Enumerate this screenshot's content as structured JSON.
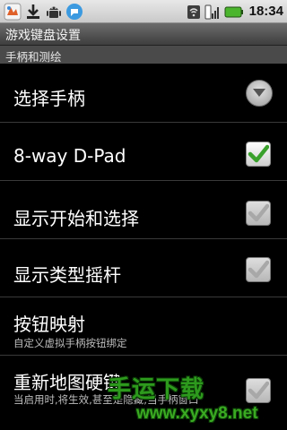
{
  "status_bar": {
    "time": "18:34",
    "icons": [
      "app-icon",
      "download-icon",
      "android-icon",
      "chat-icon",
      "wifi-icon",
      "signal-icon",
      "battery-icon"
    ]
  },
  "title_bar": {
    "title": "游戏键盘设置"
  },
  "category": {
    "label": "手柄和测绘"
  },
  "preferences": [
    {
      "title": "选择手柄",
      "widget": "dropdown"
    },
    {
      "title": "8-way D-Pad",
      "widget": "checkbox",
      "checked": true,
      "enabled": true
    },
    {
      "title": "显示开始和选择",
      "widget": "checkbox",
      "checked": true,
      "enabled": false
    },
    {
      "title": "显示类型摇杆",
      "widget": "checkbox",
      "checked": true,
      "enabled": false
    },
    {
      "title": "按钮映射",
      "summary": "自定义虚拟手柄按钮绑定"
    },
    {
      "title": "重新地图硬键",
      "summary": "当启用时,将生效,甚至是隐藏,当手柄窗口",
      "widget": "checkbox",
      "checked": true,
      "enabled": false
    }
  ],
  "watermark": {
    "text": "手运下载",
    "url": "www.xyxy8.net"
  },
  "colors": {
    "check_enabled": "#3aa12c",
    "check_disabled": "#a8a8a8"
  }
}
